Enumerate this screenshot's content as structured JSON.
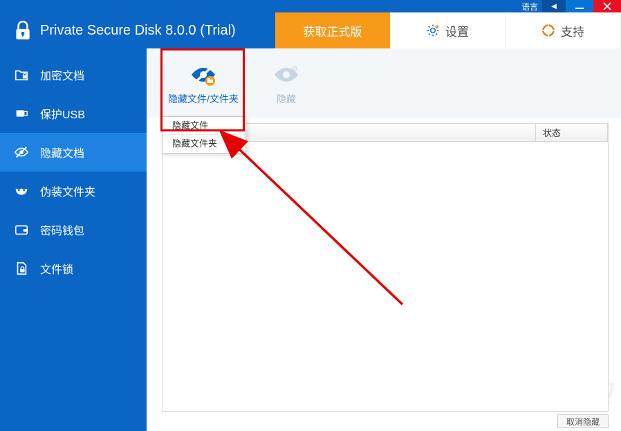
{
  "titlebar": {
    "language_label": "语言",
    "language_button_glyph": "◀"
  },
  "header": {
    "app_title": "Private Secure Disk 8.0.0 (Trial)",
    "tabs": {
      "get_full": "获取正式版",
      "settings": "设置",
      "support": "支持"
    }
  },
  "sidebar": {
    "items": [
      {
        "label": "加密文档"
      },
      {
        "label": "保护USB"
      },
      {
        "label": "隐藏文档"
      },
      {
        "label": "伪装文件夹"
      },
      {
        "label": "密码钱包"
      },
      {
        "label": "文件锁"
      }
    ]
  },
  "toolbar": {
    "hide_files_folders": "隐藏文件/文件夹",
    "hide": "隐藏"
  },
  "dropdown": {
    "hide_file": "隐藏文件",
    "hide_folder": "隐藏文件夹"
  },
  "table": {
    "col_path": "",
    "col_status": "状态"
  },
  "footer": {
    "unhide_button": "取消隐藏"
  },
  "watermark": "下载吧"
}
